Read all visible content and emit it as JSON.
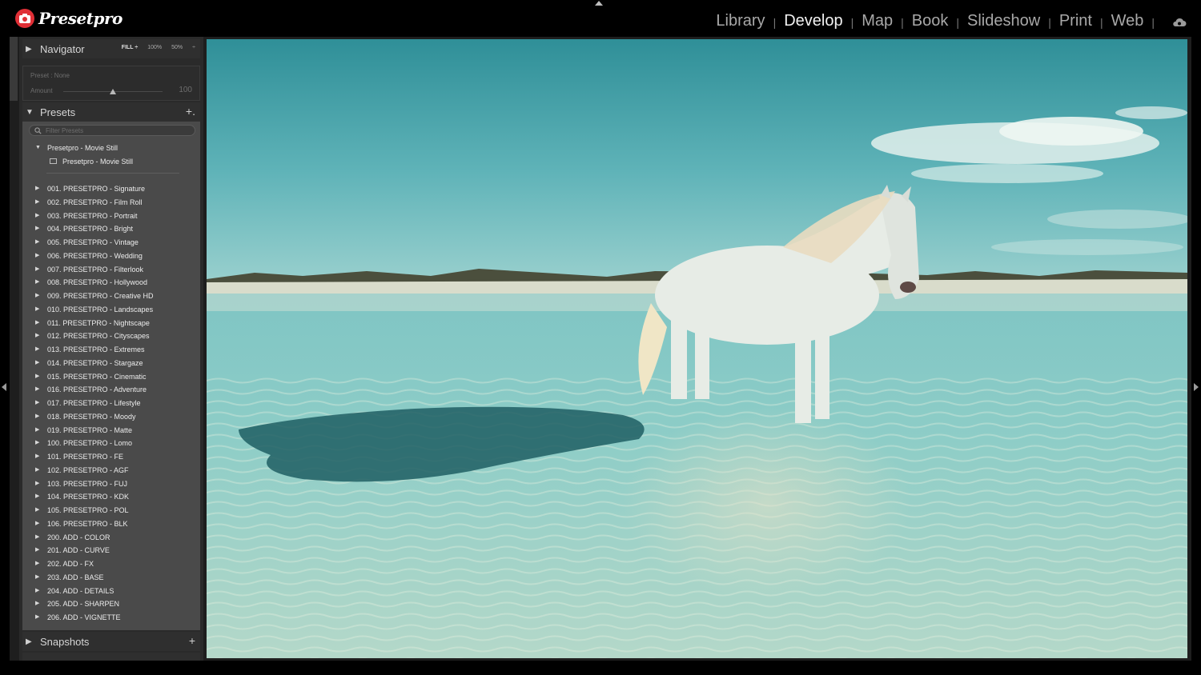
{
  "app": {
    "brand": "Presetpro",
    "modules": [
      {
        "label": "Library",
        "active": false
      },
      {
        "label": "Develop",
        "active": true
      },
      {
        "label": "Map",
        "active": false
      },
      {
        "label": "Book",
        "active": false
      },
      {
        "label": "Slideshow",
        "active": false
      },
      {
        "label": "Print",
        "active": false
      },
      {
        "label": "Web",
        "active": false
      }
    ],
    "separator": "|"
  },
  "navigator": {
    "title": "Navigator",
    "zoom_options": [
      "FILL ÷",
      "100%",
      "50%",
      "÷"
    ]
  },
  "preset_amount": {
    "preset_label": "Preset : None",
    "amount_label": "Amount",
    "amount_value": "100",
    "amount_fraction": 0.5
  },
  "presets": {
    "title": "Presets",
    "add": "+.",
    "filter_placeholder": "Filter Presets",
    "open_group": {
      "label": "Presetpro - Movie Still",
      "child": "Presetpro - Movie Still"
    },
    "groups": [
      "001. PRESETPRO - Signature",
      "002. PRESETPRO - Film Roll",
      "003. PRESETPRO - Portrait",
      "004. PRESETPRO - Bright",
      "005. PRESETPRO - Vintage",
      "006. PRESETPRO - Wedding",
      "007. PRESETPRO - Filterlook",
      "008. PRESETPRO - Hollywood",
      "009. PRESETPRO - Creative HD",
      "010. PRESETPRO - Landscapes",
      "011. PRESETPRO - Nightscape",
      "012. PRESETPRO - Cityscapes",
      "013. PRESETPRO - Extremes",
      "014. PRESETPRO - Stargaze",
      "015. PRESETPRO - Cinematic",
      "016. PRESETPRO - Adventure",
      "017. PRESETPRO - Lifestyle",
      "018. PRESETPRO - Moody",
      "019. PRESETPRO - Matte",
      "100. PRESETPRO - Lomo",
      "101. PRESETPRO - FE",
      "102. PRESETPRO - AGF",
      "103. PRESETPRO - FUJ",
      "104. PRESETPRO - KDK",
      "105. PRESETPRO - POL",
      "106. PRESETPRO - BLK",
      "200. ADD - COLOR",
      "201. ADD - CURVE",
      "202. ADD - FX",
      "203. ADD - BASE",
      "204. ADD - DETAILS",
      "205. ADD - SHARPEN",
      "206. ADD - VIGNETTE"
    ]
  },
  "snapshots": {
    "title": "Snapshots",
    "add": "+"
  },
  "colors": {
    "brand_red": "#e02f36",
    "panel_bg": "#4a4a4a",
    "active_module": "#f2f2f2"
  }
}
